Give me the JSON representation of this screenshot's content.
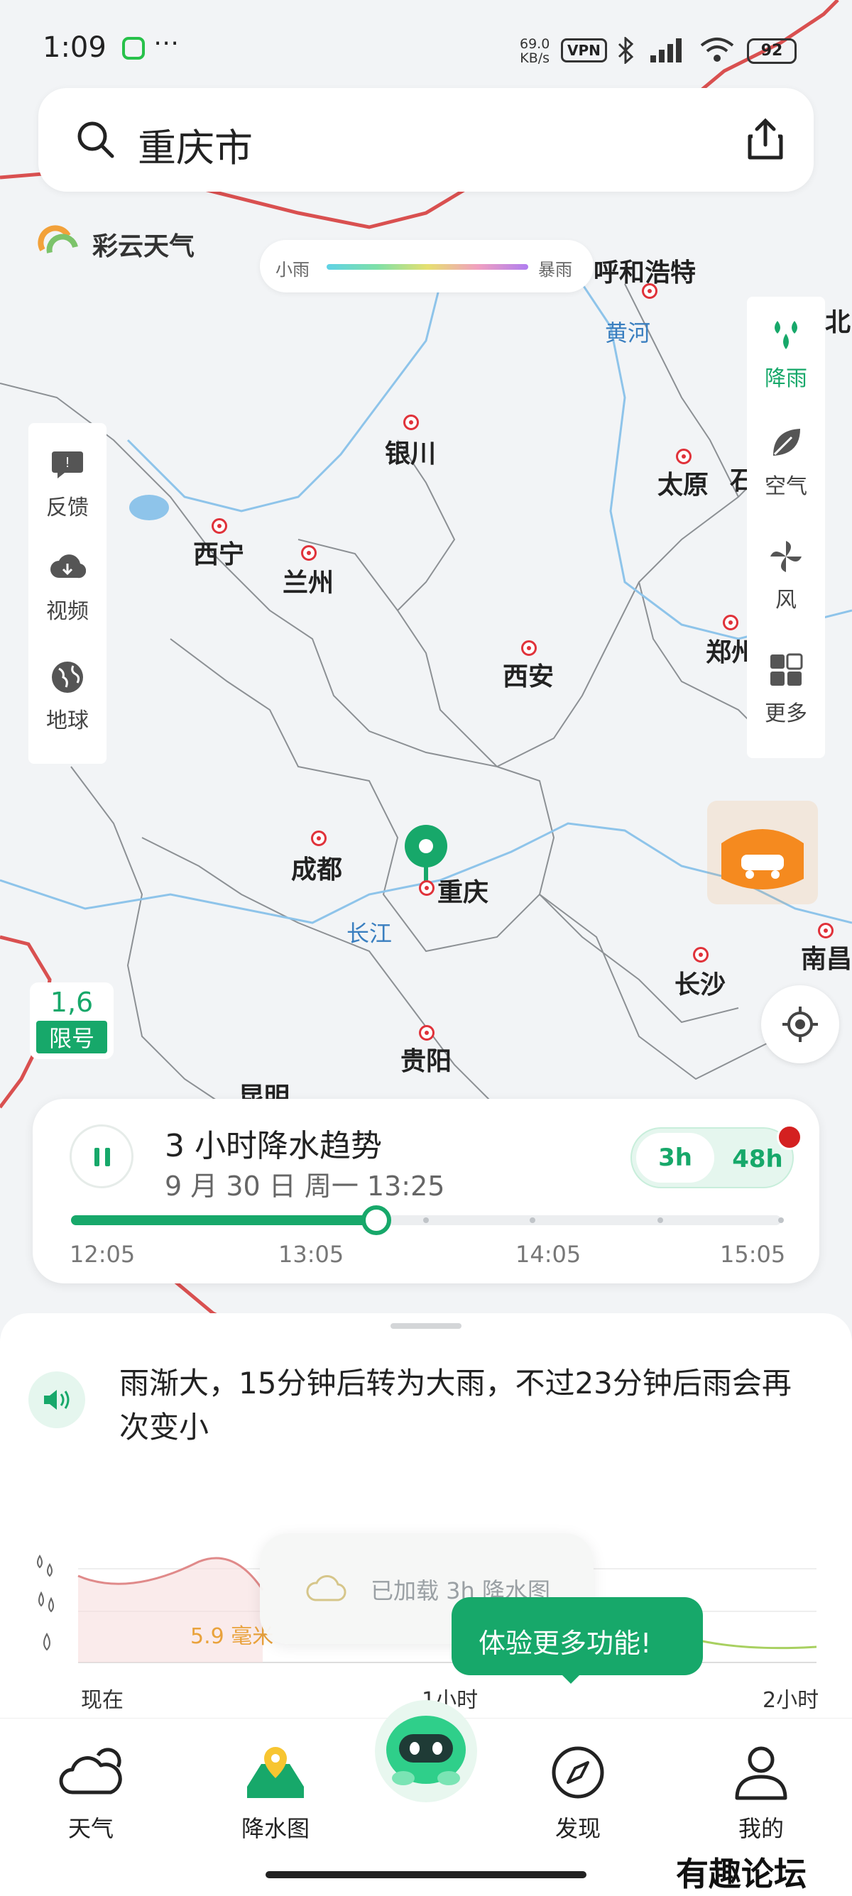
{
  "status": {
    "time": "1:09",
    "netspeed_top": "69.0",
    "netspeed_unit": "KB/s",
    "vpn": "VPN",
    "battery": "92"
  },
  "search": {
    "city": "重庆市"
  },
  "brand": {
    "name": "彩云天气"
  },
  "legend": {
    "left": "小雨",
    "right": "暴雨"
  },
  "map": {
    "cities": {
      "hohhot": "呼和浩特",
      "beijing": "北",
      "yinchuan": "银川",
      "taiyuan": "太原",
      "shi": "石",
      "xining": "西宁",
      "lanzhou": "兰州",
      "xian": "西安",
      "zhengzhou": "郑州",
      "chengdu": "成都",
      "chongqing": "重庆",
      "changsha": "长沙",
      "nanchang": "南昌",
      "guiyang": "贵阳",
      "kunming": "昆明"
    },
    "rivers": {
      "huanghe": "黄河",
      "changjiang": "长江"
    },
    "promo": "驾驶天气"
  },
  "left_panel": {
    "feedback": "反馈",
    "video": "视频",
    "globe": "地球"
  },
  "right_panel": {
    "rain": "降雨",
    "air": "空气",
    "wind": "风",
    "more": "更多"
  },
  "limit": {
    "numbers": "1,6",
    "label": "限号"
  },
  "trend": {
    "title": "3 小时降水趋势",
    "date": "9 月 30 日 周一 13:25",
    "seg_3h": "3h",
    "seg_48h": "48h",
    "progress": 0.43,
    "times": [
      "12:05",
      "13:05",
      "14:05",
      "15:05"
    ]
  },
  "sheet": {
    "description": "雨渐大，15分钟后转为大雨，不过23分钟后雨会再次变小",
    "peak": "5.9 毫米",
    "x_labels": [
      "现在",
      "1小时",
      "2小时"
    ],
    "toast": "已加载 3h 降水图",
    "bubble": "体验更多功能!"
  },
  "chart_data": {
    "type": "area",
    "x": [
      "现在",
      "1小时",
      "2小时"
    ],
    "annotations": [
      "5.9 毫米"
    ]
  },
  "tabs": {
    "weather": "天气",
    "radar": "降水图",
    "discover": "发现",
    "mine": "我的"
  },
  "watermark": "有趣论坛",
  "colors": {
    "accent": "#17a86a",
    "alert": "#d42020",
    "city_dot": "#e0323a",
    "river": "#3a7fc0"
  }
}
